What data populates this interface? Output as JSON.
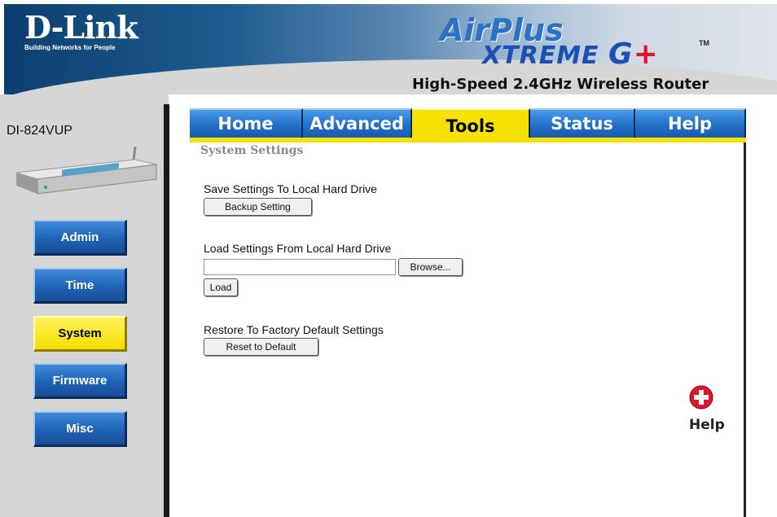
{
  "header": {
    "brand": "D-Link",
    "tagline": "Building Networks for People",
    "product_line_1": "AirPlus",
    "product_line_2": "XTREME",
    "product_line_3": "G",
    "product_plus": "+",
    "trademark": "TM",
    "model_description": "High-Speed 2.4GHz Wireless Router"
  },
  "sidebar": {
    "model_name": "DI-824VUP",
    "items": [
      {
        "label": "Admin",
        "active": false
      },
      {
        "label": "Time",
        "active": false
      },
      {
        "label": "System",
        "active": true
      },
      {
        "label": "Firmware",
        "active": false
      },
      {
        "label": "Misc",
        "active": false
      }
    ]
  },
  "tabs": [
    {
      "label": "Home",
      "active": false
    },
    {
      "label": "Advanced",
      "active": false
    },
    {
      "label": "Tools",
      "active": true
    },
    {
      "label": "Status",
      "active": false
    },
    {
      "label": "Help",
      "active": false
    }
  ],
  "main": {
    "section_title": "System Settings",
    "save": {
      "label": "Save Settings To Local Hard Drive",
      "button": "Backup Setting"
    },
    "load": {
      "label": "Load Settings From Local Hard Drive",
      "file_value": "",
      "browse_button": "Browse...",
      "load_button": "Load"
    },
    "restore": {
      "label": "Restore To Factory Default Settings",
      "button": "Reset to Default"
    },
    "help_label": "Help"
  },
  "colors": {
    "tab_blue": "#2270c8",
    "active_yellow": "#f6e100",
    "header_dark": "#0c3f6f",
    "panel_gray": "#d6d6d6",
    "help_red": "#e0142a"
  },
  "icons": {
    "help": "plus-circle-icon"
  }
}
